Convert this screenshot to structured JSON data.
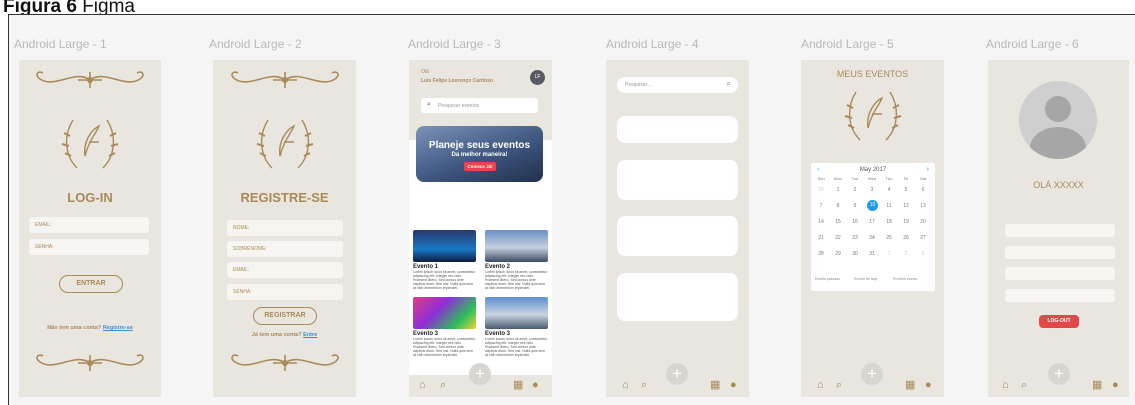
{
  "caption": {
    "prefix": "Figura 6",
    "text": "Figma"
  },
  "frames": [
    {
      "label": "Android Large - 1"
    },
    {
      "label": "Android Large - 2"
    },
    {
      "label": "Android Large - 3"
    },
    {
      "label": "Android Large - 4"
    },
    {
      "label": "Android Large - 5"
    },
    {
      "label": "Android Large - 6"
    }
  ],
  "login": {
    "title": "LOG-IN",
    "email_label": "EMAIL:",
    "password_label": "SENHA:",
    "enter_button": "ENTRAR",
    "no_account": "Não tem uma conta?",
    "register_link": "Registre-se"
  },
  "register": {
    "title": "REGISTRE-SE",
    "name_label": "NOME:",
    "surname_label": "SOBRENOME:",
    "email_label": "EMAIL:",
    "password_label": "SENHA:",
    "register_button": "REGISTRAR",
    "has_account": "Já tem uma conta?",
    "login_link": "Entre"
  },
  "home": {
    "greeting": "Olá",
    "user_name": "Luís Felipe Lourenço Cardoso",
    "avatar_initials": "LF",
    "search_placeholder": "Pesquisar eventos",
    "banner_title": "Planeje seus eventos",
    "banner_subtitle": "Da melhor maneira!",
    "banner_button": "Comece Já!",
    "events": [
      {
        "title": "Evento 1",
        "desc": "Lorem ipsum dolor sit amet, consectetur adipiscing elit. Integer nec odio. Praesent libero. Sed cursus ante dapibus diam. Sed nisi. Nulla quis sem at nibh elementum imperdiet."
      },
      {
        "title": "Evento 2",
        "desc": "Lorem ipsum dolor sit amet, consectetur adipiscing elit. Integer nec odio. Praesent libero. Sed cursus ante dapibus diam. Sed nisi. Nulla quis sem at nibh elementum imperdiet."
      },
      {
        "title": "Evento 3",
        "desc": "Lorem ipsum dolor sit amet, consectetur adipiscing elit. Integer nec odio. Praesent libero. Sed cursus ante dapibus diam. Sed nisi. Nulla quis sem at nibh elementum imperdiet."
      },
      {
        "title": "Evento 3",
        "desc": "Lorem ipsum dolor sit amet, consectetur adipiscing elit. Integer nec odio. Praesent libero. Sed cursus ante dapibus diam. Sed nisi. Nulla quis sem at nibh elementum imperdiet."
      }
    ]
  },
  "search": {
    "placeholder": "Pesquisar..."
  },
  "events": {
    "title": "MEUS EVENTOS",
    "month": "May 2017",
    "weekdays": [
      "Sun",
      "Mon",
      "Tue",
      "Wed",
      "Thu",
      "Fri",
      "Sat"
    ],
    "weeks": [
      [
        "30",
        "1",
        "2",
        "3",
        "4",
        "5",
        "6"
      ],
      [
        "7",
        "8",
        "9",
        "10",
        "11",
        "12",
        "13"
      ],
      [
        "14",
        "15",
        "16",
        "17",
        "18",
        "19",
        "20"
      ],
      [
        "21",
        "22",
        "23",
        "24",
        "25",
        "26",
        "27"
      ],
      [
        "28",
        "29",
        "30",
        "31",
        "1",
        "2",
        "3"
      ]
    ],
    "selected_day": "10",
    "footer_items": [
      "Evento passado",
      "Evento de hoje",
      "Próximo evento"
    ]
  },
  "profile": {
    "greeting": "OLÁ XXXXX",
    "logout_button": "LOG-OUT"
  },
  "colors": {
    "accent_gold": "#a98b5a",
    "logout_red": "#e24848",
    "calendar_blue": "#1e9be6",
    "phone_bg": "#e9e5df"
  }
}
